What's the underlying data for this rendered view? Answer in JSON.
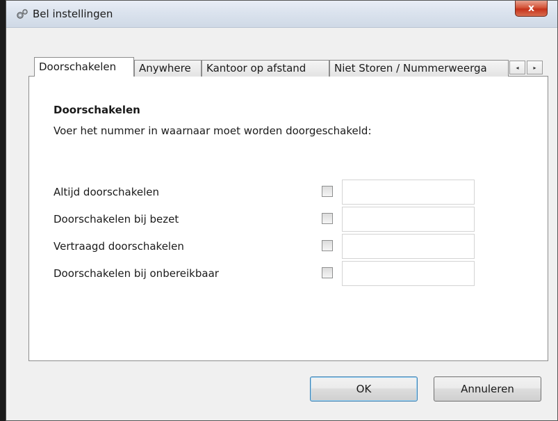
{
  "window": {
    "title": "Bel instellingen",
    "close_label": "x"
  },
  "tabs": [
    {
      "label": "Doorschakelen"
    },
    {
      "label": "Anywhere"
    },
    {
      "label": "Kantoor op afstand"
    },
    {
      "label": "Niet Storen / Nummerweerga"
    }
  ],
  "scroll": {
    "left": "◂",
    "right": "▸"
  },
  "panel": {
    "heading": "Doorschakelen",
    "description": "Voer het nummer in waarnaar moet worden doorgeschakeld:",
    "rows": [
      {
        "label": "Altijd doorschakelen",
        "checked": false,
        "value": ""
      },
      {
        "label": "Doorschakelen bij bezet",
        "checked": false,
        "value": ""
      },
      {
        "label": "Vertraagd doorschakelen",
        "checked": false,
        "value": ""
      },
      {
        "label": "Doorschakelen bij onbereikbaar",
        "checked": false,
        "value": ""
      }
    ]
  },
  "buttons": {
    "ok": "OK",
    "cancel": "Annuleren"
  }
}
